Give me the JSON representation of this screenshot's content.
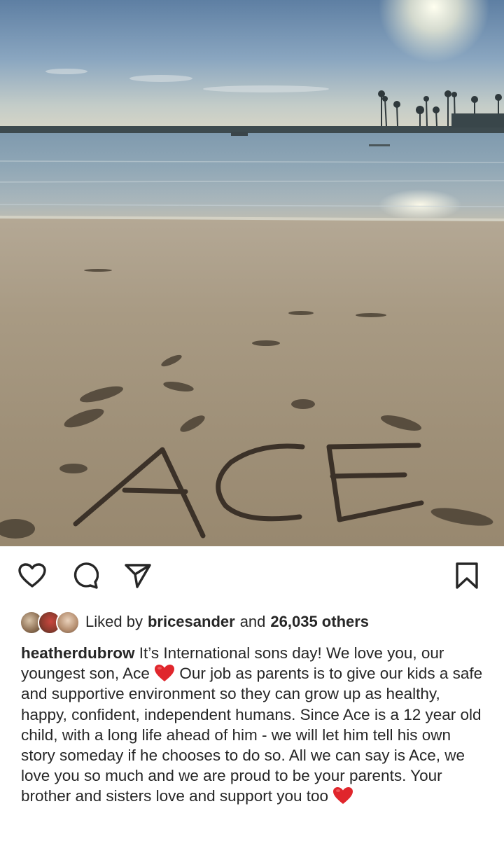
{
  "post": {
    "photo": {
      "sand_writing": "ACE"
    },
    "actions": {
      "like_icon": "heart-outline-icon",
      "comment_icon": "comment-bubble-icon",
      "share_icon": "paper-plane-icon",
      "save_icon": "bookmark-icon"
    },
    "likes": {
      "prefix": "Liked by",
      "user": "bricesander",
      "connector": "and",
      "others": "26,035 others"
    },
    "caption": {
      "username": "heatherdubrow",
      "part1": " It’s International sons day! We love you, our youngest son, Ace ",
      "part2": " Our job as parents is to give our kids a safe and supportive environment so they can grow up as healthy, happy, confident, independent humans. Since Ace is a 12 year old child, with a long life ahead of him - we will let him tell his own story someday if he chooses to do so. All we can say is Ace, we love you so much and we are proud to be your parents. Your brother and sisters love and support you too ",
      "emoji": "red-heart-emoji"
    },
    "colors": {
      "text": "#262626",
      "heart_emoji": "#e0262c"
    }
  }
}
